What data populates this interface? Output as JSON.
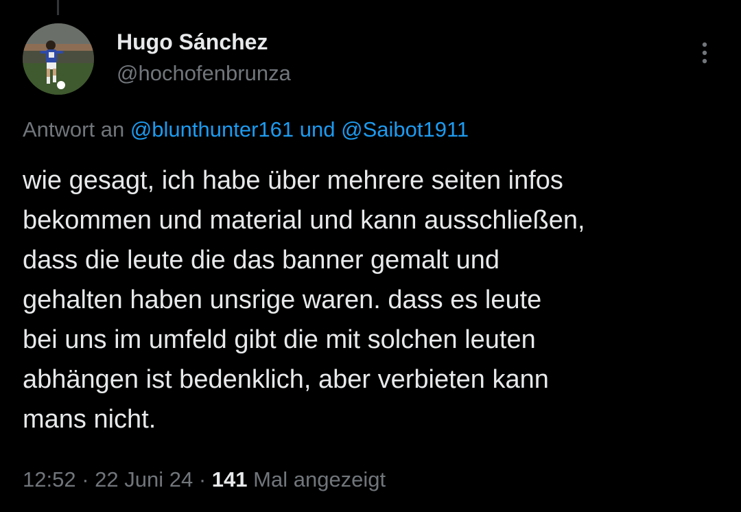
{
  "author": {
    "display_name": "Hugo Sánchez",
    "handle": "@hochofenbrunza",
    "avatar_icon": "footballer-avatar"
  },
  "reply": {
    "prefix": "Antwort an",
    "mention_1": "@blunthunter161",
    "conjunction": "und",
    "mention_2": "@Saibot1911"
  },
  "tweet": {
    "text": "wie gesagt, ich habe über mehrere seiten infos\nbekommen und material und kann ausschließen,\ndass die leute die das banner gemalt und\ngehalten haben unsrige waren. dass es leute\nbei uns im umfeld gibt die mit solchen leuten\nabhängen ist bedenklich, aber verbieten kann\nmans nicht."
  },
  "meta": {
    "time": "12:52",
    "separator_1": "·",
    "date": "22 Juni 24",
    "separator_2": "·",
    "views_count": "141",
    "views_label": "Mal angezeigt"
  },
  "icons": {
    "more": "more-vertical-icon"
  },
  "colors": {
    "background": "#000000",
    "text_primary": "#e7e9ea",
    "text_secondary": "#71767b",
    "link": "#1d9bf0",
    "thread_line": "#333639"
  }
}
